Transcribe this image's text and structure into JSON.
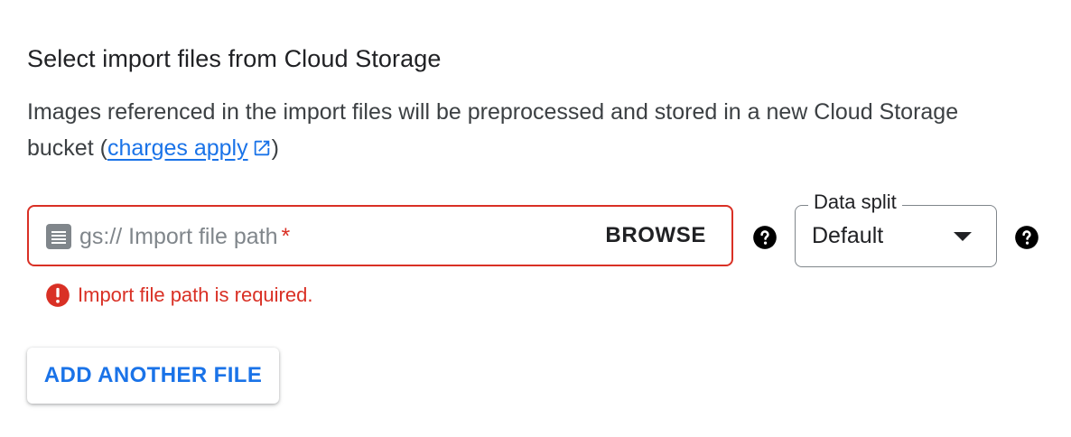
{
  "section": {
    "title": "Select import files from Cloud Storage",
    "description_prefix": "Images referenced in the import files will be preprocessed and stored in a new Cloud Storage bucket (",
    "link_text": "charges apply",
    "description_suffix": ")"
  },
  "file_input": {
    "placeholder": "gs:// Import file path",
    "required_marker": "*",
    "browse_label": "BROWSE",
    "icon": "file-document-icon"
  },
  "data_split": {
    "label": "Data split",
    "value": "Default"
  },
  "error": {
    "message": "Import file path is required."
  },
  "add_button": {
    "label": "ADD ANOTHER FILE"
  },
  "colors": {
    "error": "#d93025",
    "link": "#1a73e8",
    "text": "#202124"
  }
}
